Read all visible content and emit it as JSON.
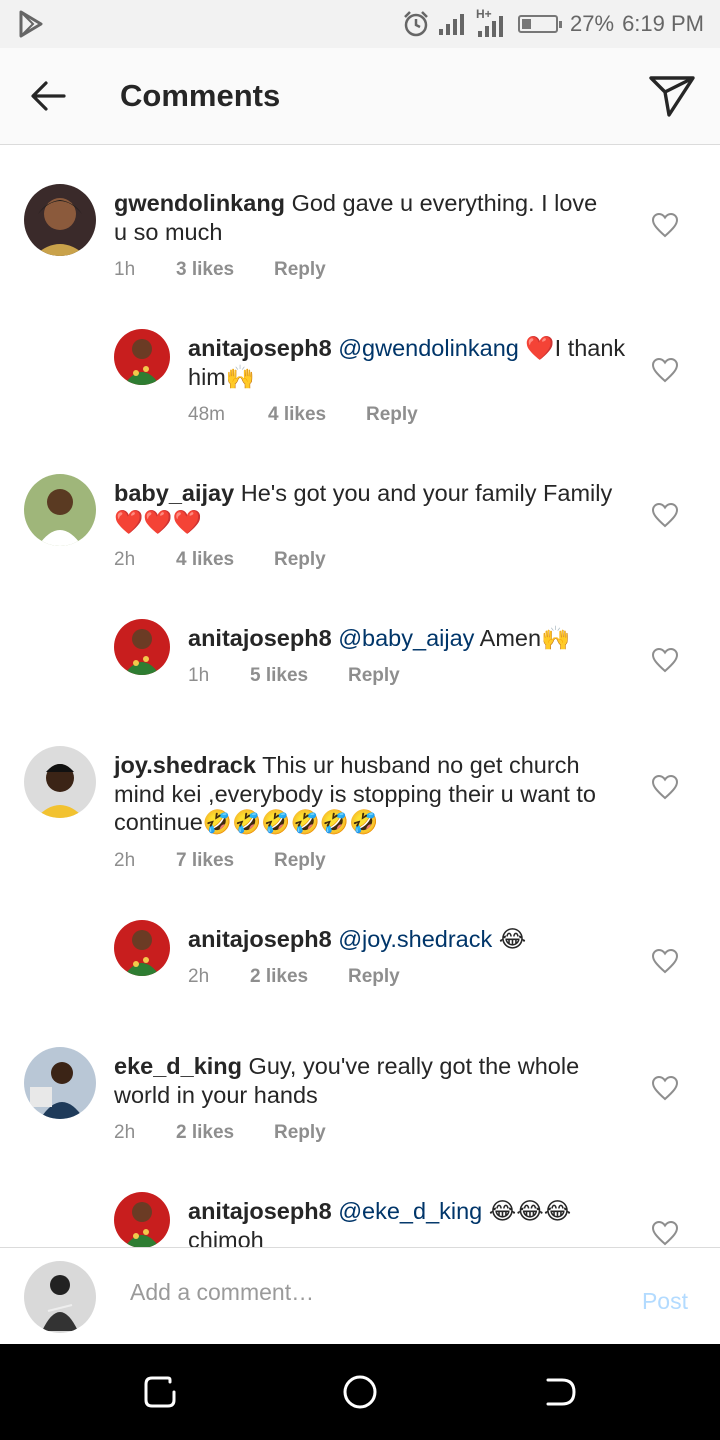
{
  "status_bar": {
    "network": "H+",
    "battery_percent": "27%",
    "battery_level": 0.27,
    "time": "6:19 PM",
    "icons": [
      "play-store-icon",
      "alarm-icon",
      "signal-icon",
      "signal-icon",
      "battery-icon"
    ]
  },
  "header": {
    "title": "Comments",
    "back_icon": "arrow-left-icon",
    "share_icon": "paper-plane-icon"
  },
  "comments": [
    {
      "username": "gwendolinkang",
      "text": "God gave u everything. I love u so much",
      "time": "1h",
      "likes": "3 likes",
      "reply": "Reply"
    },
    {
      "username": "anitajoseph8",
      "mention": "@gwendolinkang",
      "text": " ❤️I thank him🙌",
      "time": "48m",
      "likes": "4 likes",
      "reply": "Reply"
    },
    {
      "username": "baby_aijay",
      "text": "He's got you and your family Family ❤️❤️❤️",
      "time": "2h",
      "likes": "4 likes",
      "reply": "Reply"
    },
    {
      "username": "anitajoseph8",
      "mention": "@baby_aijay",
      "text": " Amen🙌",
      "time": "1h",
      "likes": "5 likes",
      "reply": "Reply"
    },
    {
      "username": "joy.shedrack",
      "text": "This ur husband no get church mind kei ,everybody is stopping their u want to continue🤣🤣🤣🤣🤣🤣",
      "time": "2h",
      "likes": "7 likes",
      "reply": "Reply"
    },
    {
      "username": "anitajoseph8",
      "mention": "@joy.shedrack",
      "text": " 😂",
      "time": "2h",
      "likes": "2 likes",
      "reply": "Reply"
    },
    {
      "username": "eke_d_king",
      "text": "Guy, you've really got the whole world in your hands",
      "time": "2h",
      "likes": "2 likes",
      "reply": "Reply"
    },
    {
      "username": "anitajoseph8",
      "mention": "@eke_d_king",
      "text": " 😂😂😂 chimoh"
    }
  ],
  "add_comment": {
    "placeholder": "Add a comment…",
    "post_label": "Post",
    "post_color": "#b3dbff"
  },
  "colors": {
    "mention": "#003569",
    "meta": "#8e8e8e",
    "text": "#262626"
  },
  "nav_bar": {
    "icons": [
      "recents-icon",
      "home-icon",
      "back-icon"
    ]
  }
}
